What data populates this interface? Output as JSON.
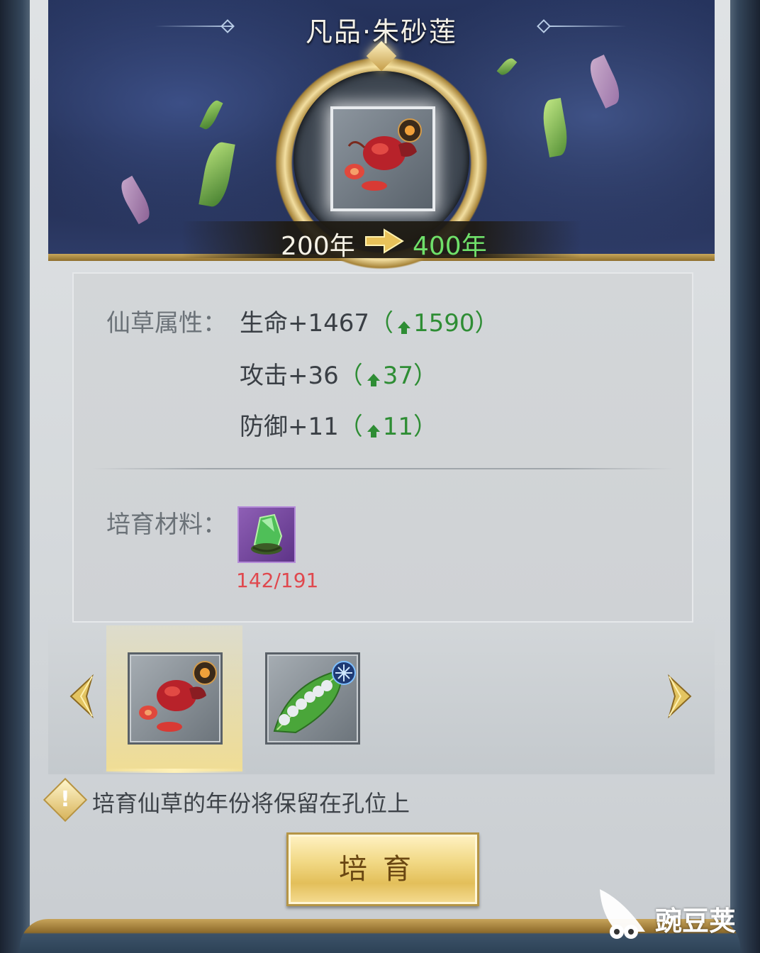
{
  "header": {
    "title": "凡品·朱砂莲",
    "year_from": "200年",
    "year_to": "400年"
  },
  "attributes": {
    "label": "仙草属性：",
    "stats": [
      {
        "text": "生命+1467",
        "open": "（",
        "next": "1590",
        "close": "）"
      },
      {
        "text": "攻击+36",
        "open": "（",
        "next": "37",
        "close": "）"
      },
      {
        "text": "防御+11",
        "open": "（",
        "next": "11",
        "close": "）"
      }
    ]
  },
  "materials": {
    "label": "培育材料：",
    "icon": "green-jade-stone-icon",
    "count": "142/191"
  },
  "selector": {
    "items": [
      {
        "icon": "cinnabar-lotus-herb-icon",
        "selected": true,
        "badge": "fire-element-badge"
      },
      {
        "icon": "leaf-silkworm-herb-icon",
        "selected": false,
        "badge": "ice-element-badge"
      }
    ]
  },
  "notice": {
    "text": "培育仙草的年份将保留在孔位上"
  },
  "actions": {
    "cultivate_label": "培育"
  },
  "watermark": {
    "text": "豌豆荚"
  },
  "colors": {
    "increase_green": "#2e8d34",
    "year_to_green": "#6fe06a",
    "insufficient_red": "#e0484e",
    "gold": "#c9a85a"
  }
}
